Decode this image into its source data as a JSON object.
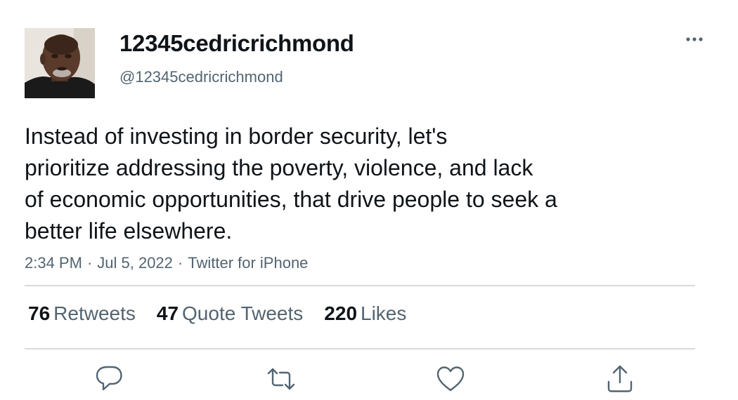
{
  "tweet": {
    "author": {
      "display_name": "12345cedricrichmond",
      "handle": "@12345cedricrichmond"
    },
    "text_lines": [
      "Instead of investing in border security, let's",
      "prioritize addressing the poverty, violence, and lack",
      "of economic opportunities, that drive people to seek a",
      "better life elsewhere."
    ],
    "meta": {
      "time": "2:34 PM",
      "date": "Jul 5, 2022",
      "source": "Twitter for iPhone",
      "separator": "·"
    },
    "stats": {
      "retweets": {
        "count": "76",
        "label": "Retweets"
      },
      "quote_tweets": {
        "count": "47",
        "label": "Quote Tweets"
      },
      "likes": {
        "count": "220",
        "label": "Likes"
      }
    },
    "actions": {
      "reply_icon": "reply-icon",
      "retweet_icon": "retweet-icon",
      "like_icon": "heart-icon",
      "share_icon": "share-icon"
    },
    "more_icon": "more-icon",
    "colors": {
      "text_primary": "#0f1419",
      "text_secondary": "#536471",
      "divider": "#d6dadd"
    }
  }
}
